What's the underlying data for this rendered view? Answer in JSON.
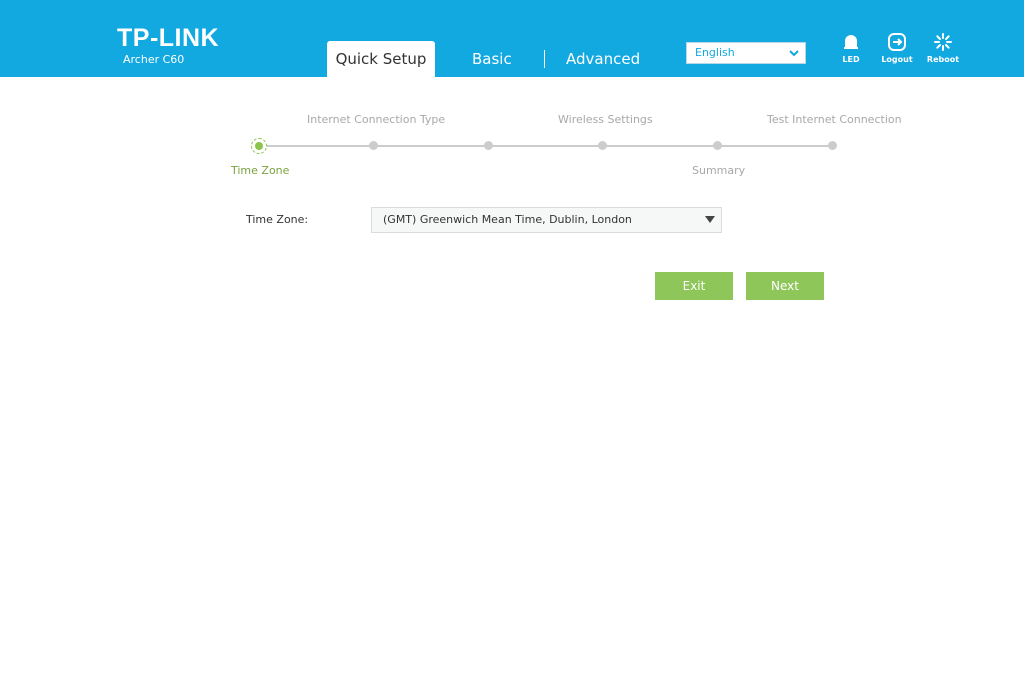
{
  "brand": {
    "logo": "TP-LINK",
    "model": "Archer C60"
  },
  "tabs": {
    "quick_setup": "Quick Setup",
    "basic": "Basic",
    "advanced": "Advanced",
    "active": "quick_setup"
  },
  "language": {
    "selected": "English"
  },
  "header_icons": [
    {
      "name": "led-icon",
      "label": "LED"
    },
    {
      "name": "logout-icon",
      "label": "Logout"
    },
    {
      "name": "reboot-icon",
      "label": "Reboot"
    }
  ],
  "steps": [
    {
      "label": "Time Zone",
      "active": true
    },
    {
      "label": "Internet Connection Type",
      "active": false
    },
    {
      "label": "Wireless Settings",
      "active": false
    },
    {
      "label": "Summary",
      "active": false
    },
    {
      "label": "Test Internet Connection",
      "active": false
    }
  ],
  "form": {
    "time_zone_label": "Time Zone:",
    "time_zone_value": "(GMT) Greenwich Mean Time, Dublin, London"
  },
  "buttons": {
    "exit": "Exit",
    "next": "Next"
  },
  "colors": {
    "header": "#12a8e0",
    "accent_green": "#8ec65a",
    "step_active": "#7ba23f",
    "step_inactive": "#a8a8a8"
  }
}
